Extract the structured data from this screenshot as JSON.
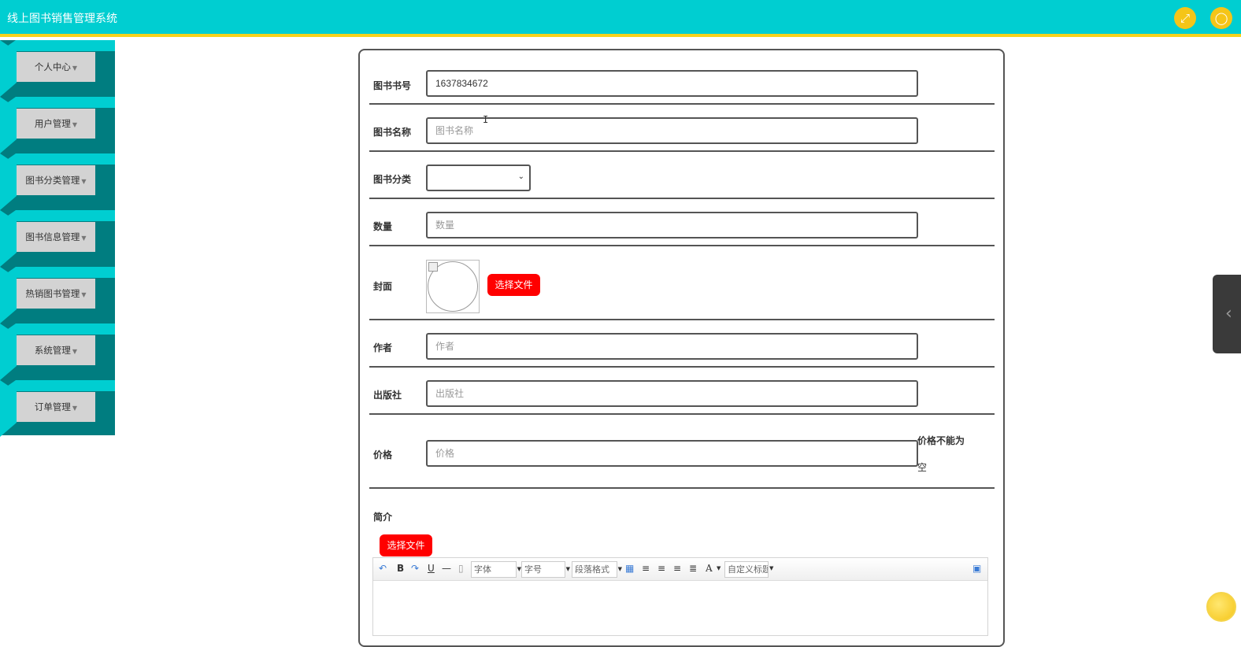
{
  "app": {
    "title": "线上图书销售管理系统"
  },
  "header": {
    "fullscreen_icon": "expand-icon",
    "user_icon": "user-icon"
  },
  "sidebar": {
    "items": [
      {
        "label": "个人中心"
      },
      {
        "label": "用户管理"
      },
      {
        "label": "图书分类管理"
      },
      {
        "label": "图书信息管理"
      },
      {
        "label": "热销图书管理"
      },
      {
        "label": "系统管理"
      },
      {
        "label": "订单管理"
      }
    ]
  },
  "form": {
    "book_no": {
      "label": "图书书号",
      "value": "1637834672"
    },
    "book_name": {
      "label": "图书名称",
      "placeholder": "图书名称"
    },
    "category": {
      "label": "图书分类",
      "value": ""
    },
    "quantity": {
      "label": "数量",
      "placeholder": "数量"
    },
    "cover": {
      "label": "封面",
      "button": "选择文件"
    },
    "author": {
      "label": "作者",
      "placeholder": "作者"
    },
    "publisher": {
      "label": "出版社",
      "placeholder": "出版社"
    },
    "price": {
      "label": "价格",
      "placeholder": "价格",
      "error_line1": "价格不能为",
      "error_line2": "空"
    },
    "intro": {
      "label": "简介",
      "button": "选择文件"
    }
  },
  "editor": {
    "font_select": "字体",
    "size_select": "字号",
    "paragraph_select": "段落格式",
    "custom_title_select": "自定义标题",
    "bold": "B",
    "underline": "U",
    "font_color": "A"
  },
  "colors": {
    "header": "#00ced1",
    "accent_bar": "#f7d21b",
    "sidebar": "#007d80",
    "button_red": "#ff0000"
  }
}
